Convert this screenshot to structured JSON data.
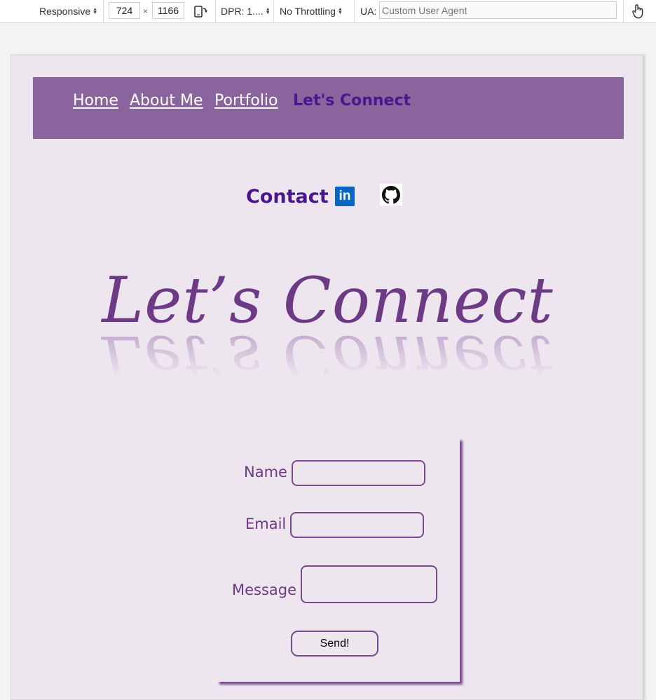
{
  "devtools": {
    "device": "Responsive",
    "width": "724",
    "times": "×",
    "height": "1166",
    "dpr": "DPR: 1....",
    "throttling": "No Throttling",
    "ua_label": "UA:",
    "ua_placeholder": "Custom User Agent",
    "icons": [
      "rotate-icon",
      "touch-icon"
    ]
  },
  "nav": {
    "items": [
      {
        "label": "Home",
        "active": false
      },
      {
        "label": "About Me",
        "active": false
      },
      {
        "label": "Portfolio",
        "active": false
      },
      {
        "label": "Let's Connect",
        "active": true
      }
    ]
  },
  "contact": {
    "label": "Contact",
    "linkedin_text": "in",
    "icons": [
      "linkedin-icon",
      "github-icon"
    ]
  },
  "headline": "Let’s Connect",
  "form": {
    "name_label": "Name",
    "email_label": "Email",
    "message_label": "Message",
    "send_label": "Send!"
  },
  "colors": {
    "nav_bg": "#8a649d",
    "page_bg": "#ede6ef",
    "accent": "#4a168e",
    "form_border": "#7a4a8e"
  }
}
